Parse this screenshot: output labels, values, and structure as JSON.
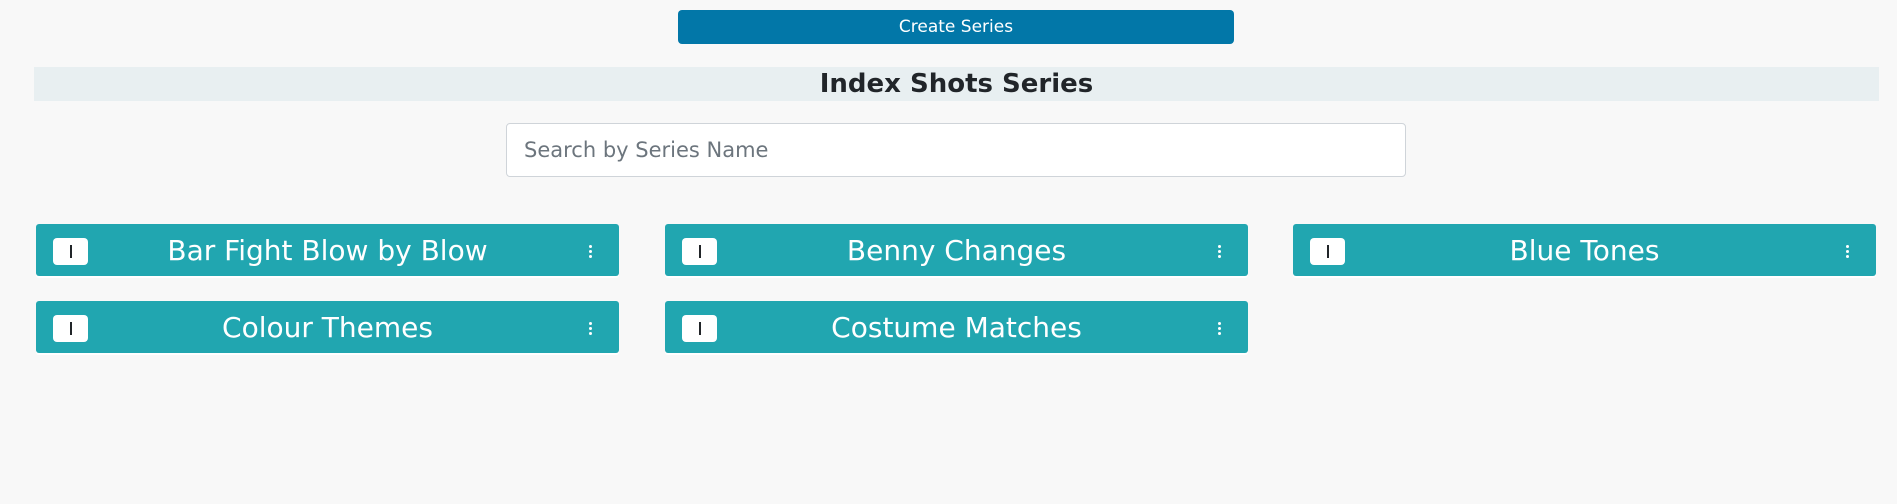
{
  "toolbar": {
    "create_label": "Create Series"
  },
  "page": {
    "title": "Index Shots Series"
  },
  "search": {
    "placeholder": "Search by Series Name",
    "value": ""
  },
  "series": [
    {
      "name": "Bar Fight Blow by Blow",
      "info_icon": "info-icon",
      "menu_icon": "kebab-menu-icon"
    },
    {
      "name": "Benny Changes",
      "info_icon": "info-icon",
      "menu_icon": "kebab-menu-icon"
    },
    {
      "name": "Blue Tones",
      "info_icon": "info-icon",
      "menu_icon": "kebab-menu-icon"
    },
    {
      "name": "Colour Themes",
      "info_icon": "info-icon",
      "menu_icon": "kebab-menu-icon"
    },
    {
      "name": "Costume Matches",
      "info_icon": "info-icon",
      "menu_icon": "kebab-menu-icon"
    }
  ],
  "colors": {
    "primary_button": "#0277a8",
    "card": "#21a6b0",
    "title_bar": "#e8eff1",
    "background": "#f8f8f8"
  }
}
